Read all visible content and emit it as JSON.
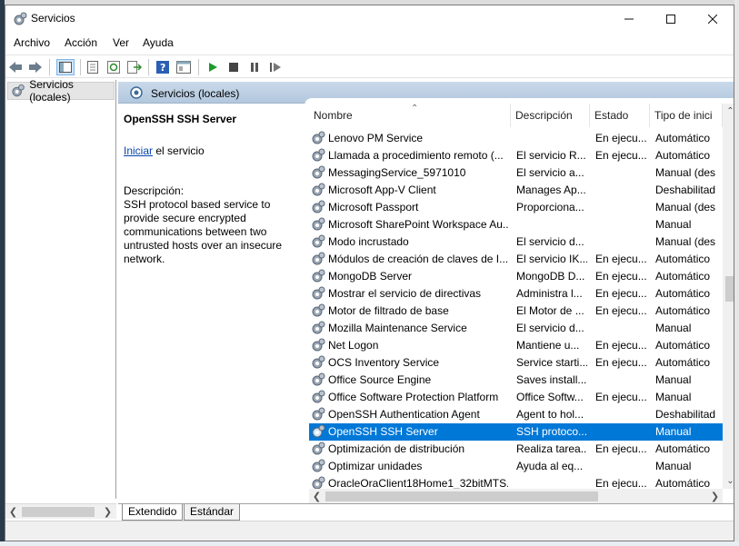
{
  "window": {
    "title": "Servicios"
  },
  "menu": [
    "Archivo",
    "Acción",
    "Ver",
    "Ayuda"
  ],
  "toolbar": {
    "icons": [
      "back-arrow-icon",
      "forward-arrow-icon",
      "console-tree-icon",
      "properties-icon",
      "refresh-icon",
      "export-list-icon",
      "help-icon",
      "view-icon",
      "play-icon",
      "stop-icon",
      "pause-icon",
      "restart-icon"
    ]
  },
  "tree": {
    "item": "Servicios (locales)"
  },
  "panel": {
    "header": "Servicios (locales)"
  },
  "description": {
    "service_name": "OpenSSH SSH Server",
    "start_link": "Iniciar",
    "start_rest": " el servicio",
    "label": "Descripción:",
    "text": "SSH protocol based service to provide secure encrypted communications between two untrusted hosts over an insecure network."
  },
  "columns": {
    "name": "Nombre",
    "description": "Descripción",
    "state": "Estado",
    "type": "Tipo de inici"
  },
  "services": [
    {
      "name": "Lenovo PM Service",
      "desc": "",
      "state": "En ejecu...",
      "type": "Automático"
    },
    {
      "name": "Llamada a procedimiento remoto (...",
      "desc": "El servicio R...",
      "state": "En ejecu...",
      "type": "Automático"
    },
    {
      "name": "MessagingService_5971010",
      "desc": "El servicio a...",
      "state": "",
      "type": "Manual (des"
    },
    {
      "name": "Microsoft App-V Client",
      "desc": "Manages Ap...",
      "state": "",
      "type": "Deshabilitad"
    },
    {
      "name": "Microsoft Passport",
      "desc": "Proporciona...",
      "state": "",
      "type": "Manual (des"
    },
    {
      "name": "Microsoft SharePoint Workspace Au...",
      "desc": "",
      "state": "",
      "type": "Manual"
    },
    {
      "name": "Modo incrustado",
      "desc": "El servicio d...",
      "state": "",
      "type": "Manual (des"
    },
    {
      "name": "Módulos de creación de claves de I...",
      "desc": "El servicio IK...",
      "state": "En ejecu...",
      "type": "Automático"
    },
    {
      "name": "MongoDB Server",
      "desc": "MongoDB D...",
      "state": "En ejecu...",
      "type": "Automático"
    },
    {
      "name": "Mostrar el servicio de directivas",
      "desc": "Administra l...",
      "state": "En ejecu...",
      "type": "Automático"
    },
    {
      "name": "Motor de filtrado de base",
      "desc": "El Motor de ...",
      "state": "En ejecu...",
      "type": "Automático"
    },
    {
      "name": "Mozilla Maintenance Service",
      "desc": "El servicio d...",
      "state": "",
      "type": "Manual"
    },
    {
      "name": "Net Logon",
      "desc": "Mantiene u...",
      "state": "En ejecu...",
      "type": "Automático"
    },
    {
      "name": "OCS Inventory Service",
      "desc": "Service starti...",
      "state": "En ejecu...",
      "type": "Automático"
    },
    {
      "name": "Office  Source Engine",
      "desc": "Saves install...",
      "state": "",
      "type": "Manual"
    },
    {
      "name": "Office Software Protection Platform",
      "desc": "Office Softw...",
      "state": "En ejecu...",
      "type": "Manual"
    },
    {
      "name": "OpenSSH Authentication Agent",
      "desc": "Agent to hol...",
      "state": "",
      "type": "Deshabilitad"
    },
    {
      "name": "OpenSSH SSH Server",
      "desc": "SSH protoco...",
      "state": "",
      "type": "Manual",
      "selected": true
    },
    {
      "name": "Optimización de distribución",
      "desc": "Realiza tarea...",
      "state": "En ejecu...",
      "type": "Automático"
    },
    {
      "name": "Optimizar unidades",
      "desc": "Ayuda al eq...",
      "state": "",
      "type": "Manual"
    },
    {
      "name": "OracleOraClient18Home1_32bitMTS...",
      "desc": "",
      "state": "En ejecu...",
      "type": "Automático"
    }
  ],
  "tabs": [
    "Extendido",
    "Estándar"
  ],
  "colors": {
    "selection": "#0078d7",
    "header_bg": "#c9d9ea",
    "link": "#0645ad"
  }
}
